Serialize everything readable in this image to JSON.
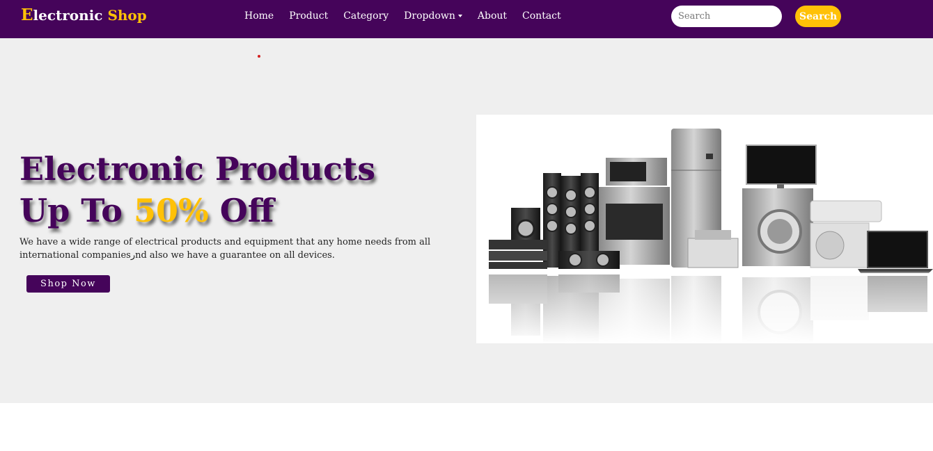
{
  "brand": {
    "first_letter": "E",
    "rest": "lectronic",
    "accent": "Shop"
  },
  "nav": {
    "items": [
      "Home",
      "Product",
      "Category",
      "Dropdown",
      "About",
      "Contact"
    ]
  },
  "search": {
    "placeholder": "Search",
    "button": "Search"
  },
  "hero": {
    "title_line1": "Electronic Products",
    "title_line2_prefix": "Up To ",
    "title_highlight": "50%",
    "title_line2_suffix": " Off",
    "description": "We have a wide range of electrical products and equipment that any home needs from all international companiesرnd also we have a guarantee on all devices.",
    "cta": "Shop Now"
  },
  "colors": {
    "primary": "#45045a",
    "accent": "#ffc107",
    "hero_bg": "#efefef"
  },
  "icons": {
    "dropdown": "caret-down-icon"
  }
}
